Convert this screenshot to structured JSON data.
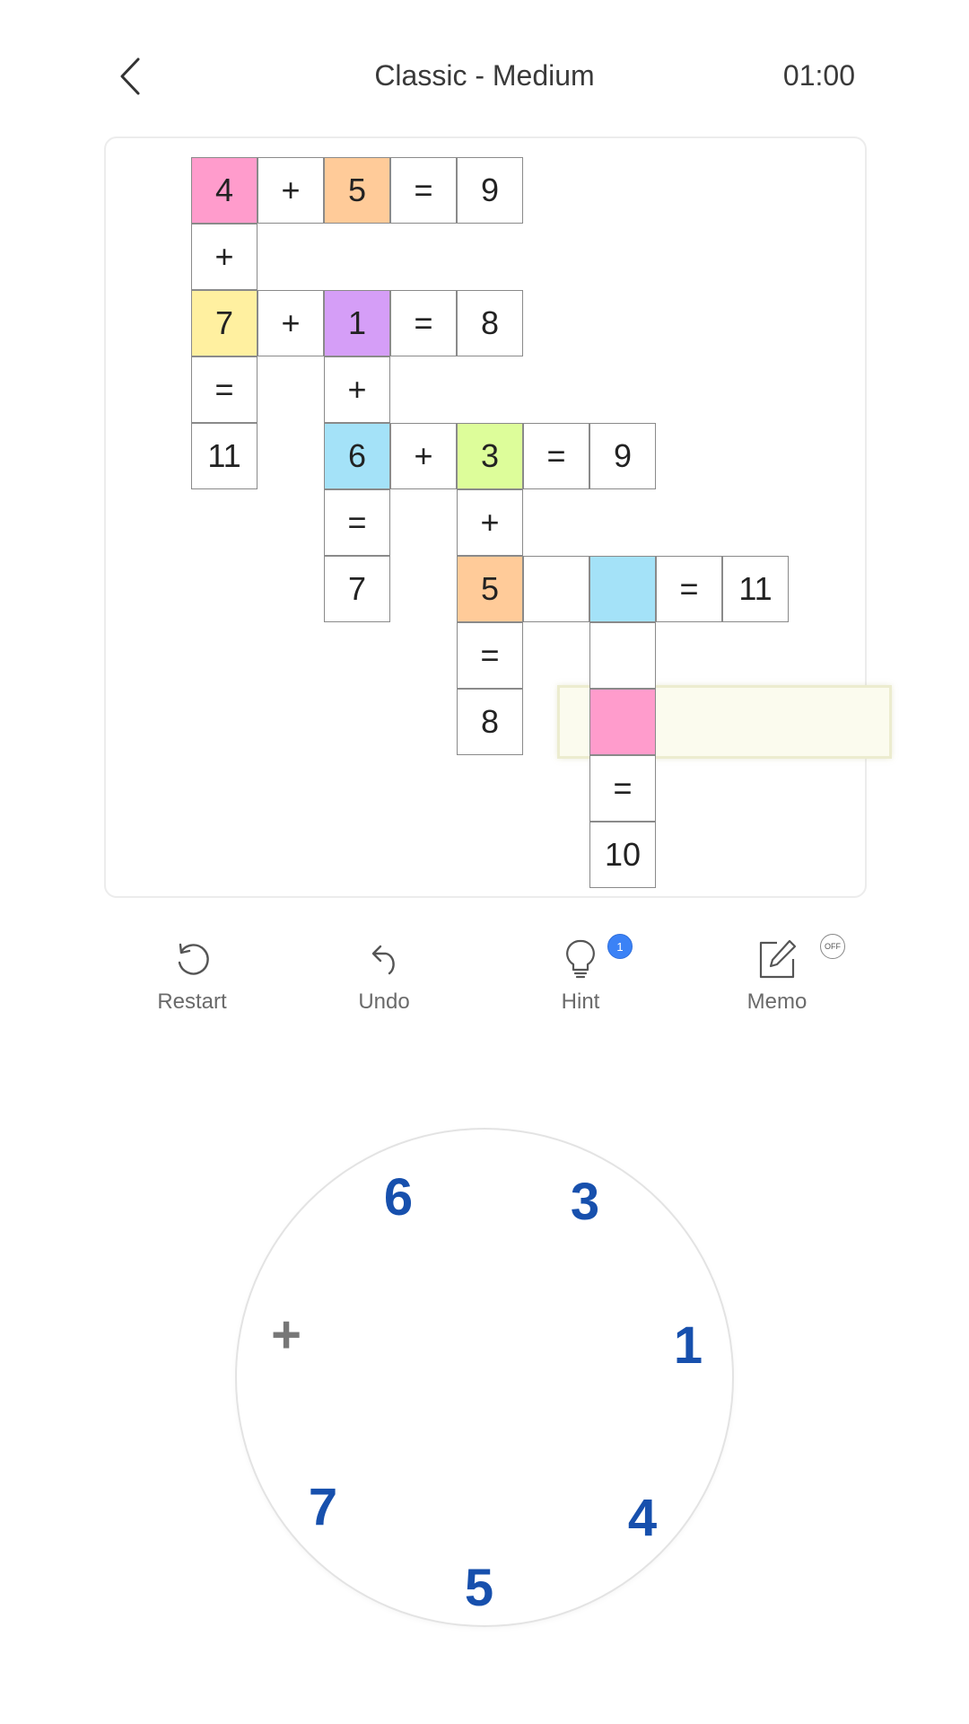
{
  "header": {
    "title": "Classic - Medium",
    "timer": "01:00",
    "back_icon": "chevron-left-icon"
  },
  "colors": {
    "pink": "#ff9ccc",
    "orange": "#ffcb99",
    "yellow": "#fff0a0",
    "purple": "#d59ef7",
    "blue": "#a4e2f8",
    "green": "#ddfd9a",
    "accent_blue": "#1750ad",
    "hint_badge": "#3b82f6"
  },
  "grid": {
    "r0": [
      "4",
      "+",
      "5",
      "=",
      "9"
    ],
    "r1": [
      "+"
    ],
    "r2": [
      "7",
      "+",
      "1",
      "=",
      "8"
    ],
    "r3": [
      "=",
      "+"
    ],
    "r4": [
      "11",
      "6",
      "+",
      "3",
      "=",
      "9"
    ],
    "r5": [
      "=",
      "+"
    ],
    "r6": [
      "7",
      "5",
      "",
      "",
      "=",
      "11"
    ],
    "r7": [
      "=",
      ""
    ],
    "r8": [
      "8",
      ""
    ],
    "r9": [
      "="
    ],
    "r10": [
      "10"
    ]
  },
  "tools": {
    "restart": {
      "label": "Restart",
      "icon": "restart-icon"
    },
    "undo": {
      "label": "Undo",
      "icon": "undo-icon"
    },
    "hint": {
      "label": "Hint",
      "icon": "lightbulb-icon",
      "badge": "1"
    },
    "memo": {
      "label": "Memo",
      "icon": "pencil-edit-icon",
      "toggle": "OFF"
    }
  },
  "dial": {
    "keys": [
      "6",
      "3",
      "+",
      "1",
      "7",
      "4",
      "5"
    ]
  }
}
